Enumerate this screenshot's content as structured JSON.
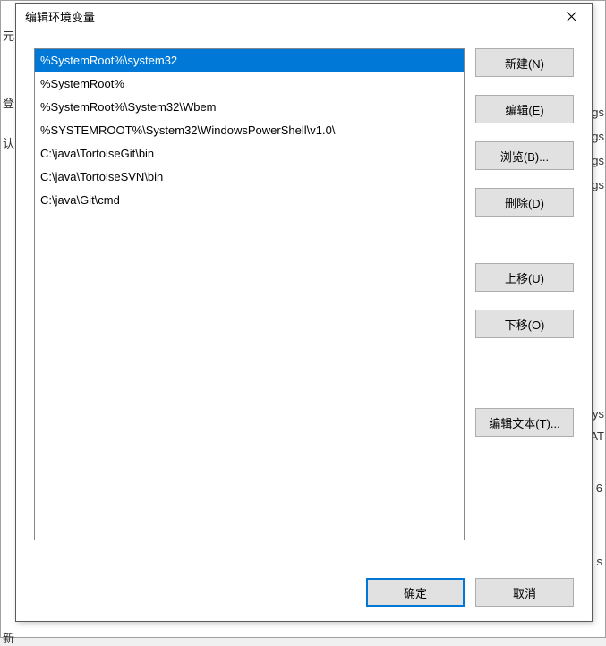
{
  "bg": {
    "left1": "元",
    "left2": "登",
    "left3": "认",
    "left4": "新",
    "r1": "gs",
    "r2": "gs",
    "r3": "gs",
    "r4": "gs",
    "r5": "ys",
    "r6": "AT",
    "r7": "6",
    "r8": "s"
  },
  "dialog": {
    "title": "编辑环境变量",
    "items": [
      "%SystemRoot%\\system32",
      "%SystemRoot%",
      "%SystemRoot%\\System32\\Wbem",
      "%SYSTEMROOT%\\System32\\WindowsPowerShell\\v1.0\\",
      "C:\\java\\TortoiseGit\\bin",
      "C:\\java\\TortoiseSVN\\bin",
      "C:\\java\\Git\\cmd"
    ],
    "selected_index": 0,
    "buttons": {
      "new": "新建(N)",
      "edit": "编辑(E)",
      "browse": "浏览(B)...",
      "delete": "删除(D)",
      "move_up": "上移(U)",
      "move_down": "下移(O)",
      "edit_text": "编辑文本(T)...",
      "ok": "确定",
      "cancel": "取消"
    }
  }
}
